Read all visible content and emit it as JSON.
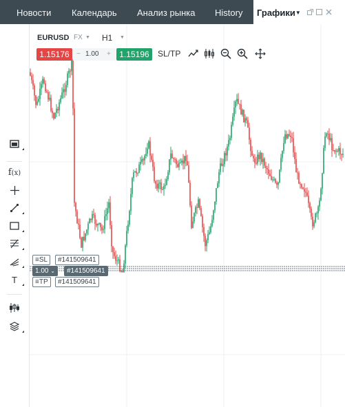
{
  "tabs": [
    {
      "label": "Новости"
    },
    {
      "label": "Календарь"
    },
    {
      "label": "Анализ рынка"
    },
    {
      "label": "History"
    },
    {
      "label": "Графики"
    }
  ],
  "toolbar": {
    "symbol": "EURUSD",
    "symbol_type": "FX",
    "timeframe": "H1",
    "sell_price": "1.15176",
    "lot_minus": "−",
    "lot_value": "1.00",
    "lot_plus": "+",
    "buy_price": "1.15196",
    "sltp_label": "SL/TP"
  },
  "sidebar_tools": [
    "bar-chart-icon",
    "function-icon",
    "crosshair-icon",
    "trendline-icon",
    "rectangle-icon",
    "fibonacci-icon",
    "pitchfork-icon",
    "text-icon",
    "candles-icon",
    "layers-icon"
  ],
  "order": {
    "sl_label": "≡SL",
    "sl_ticket": "#141509641",
    "volume": "1.00",
    "position_ticket": "#141509641",
    "tp_label": "≡TP",
    "tp_ticket": "#141509641"
  },
  "colors": {
    "tab_bar": "#3d4a52",
    "bull": "#21a36a",
    "bear": "#e64545",
    "tag_dark": "#596871"
  }
}
